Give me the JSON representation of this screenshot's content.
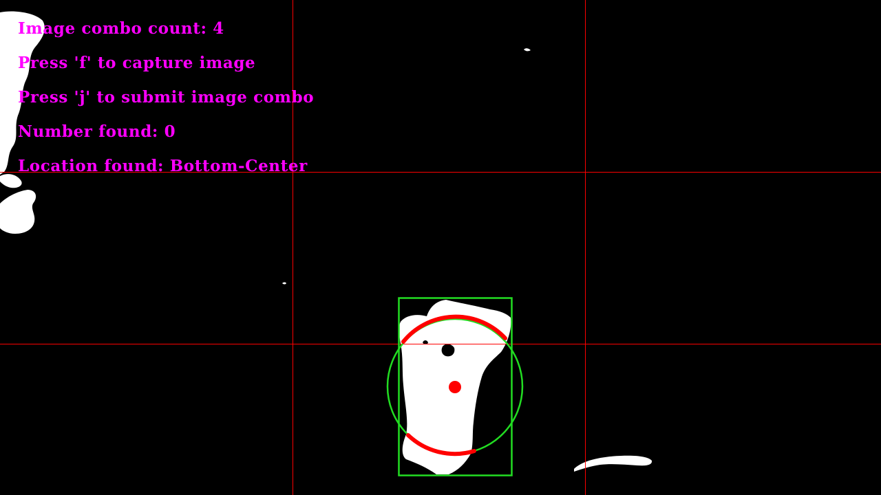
{
  "colors": {
    "background": "#000000",
    "text": "#ff00ff",
    "grid": "#ff0000",
    "blob": "#ffffff",
    "bounding_box": "#22dd22",
    "min_enclosing_circle": "#22dd22",
    "contour_ellipse": "#ff0000",
    "centroid": "#ff0000"
  },
  "overlay": {
    "combo_count": "Image combo count: 4",
    "capture_hint": "Press 'f' to capture image",
    "submit_hint": "Press 'j' to submit image combo",
    "number_found": "Number found: 0",
    "location_found": "Location found: Bottom-Center"
  }
}
